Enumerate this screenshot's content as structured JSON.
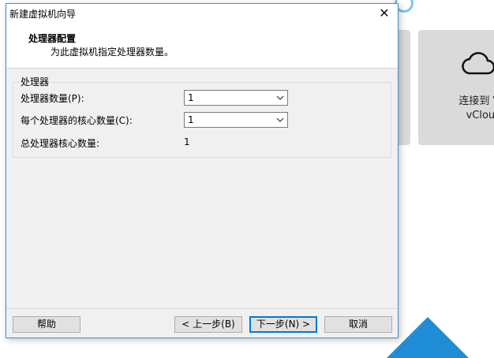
{
  "background": {
    "card_label_line1": "连接到 VM",
    "card_label_line2": "vCloud",
    "card_icon": "cloud-icon",
    "accent_color": "#1e8dd6"
  },
  "dialog": {
    "window_title": "新建虚拟机向导",
    "close_symbol": "✕",
    "header_title": "处理器配置",
    "header_subtitle": "为此虚拟机指定处理器数量。",
    "group_label": "处理器",
    "processor_count_label": "处理器数量(P):",
    "processor_count_value": "1",
    "cores_per_processor_label": "每个处理器的核心数量(C):",
    "cores_per_processor_value": "1",
    "total_cores_label": "总处理器核心数量:",
    "total_cores_value": "1",
    "help_button": "帮助",
    "back_button": "< 上一步(B)",
    "next_button": "下一步(N) >",
    "cancel_button": "取消"
  }
}
